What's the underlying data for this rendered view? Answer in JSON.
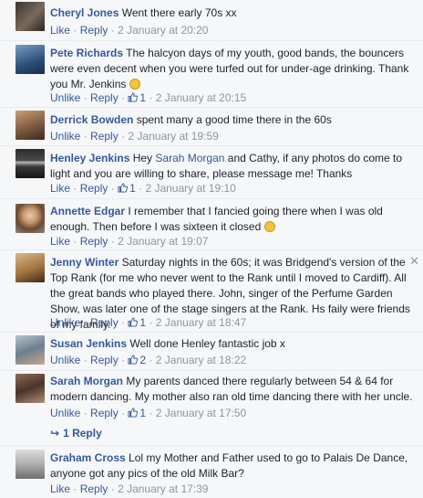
{
  "labels": {
    "unlike": "Unlike",
    "like": "Like",
    "reply": "Reply",
    "dot": "·"
  },
  "comments": [
    {
      "author": "Cheryl Jones",
      "text": "Went there early 70s xx",
      "action": "Like",
      "likes": "",
      "time": "2 January at 20:20"
    },
    {
      "author": "Pete Richards",
      "text": "The halcyon days of my youth, good bands, the bouncers were even decent when you were turfed out for under-age drinking. Thank you Mr. Jenkins",
      "action": "Unlike",
      "likes": "1",
      "time": "2 January at 20:15"
    },
    {
      "author": "Derrick Bowden",
      "text": "spent many a good time there in the 60s",
      "action": "Unlike",
      "likes": "",
      "time": "2 January at 19:59"
    },
    {
      "author": "Henley Jenkins",
      "text_before": "Hey ",
      "mention": "Sarah Morgan",
      "text_after": " and Cathy, if any photos do come to light and you are willing to share, please message me! Thanks",
      "action": "Like",
      "likes": "1",
      "time": "2 January at 19:10"
    },
    {
      "author": "Annette Edgar",
      "text": "I remember that I fancied going there when I was old enough. Then before I was sixteen it closed",
      "action": "Like",
      "likes": "",
      "time": "2 January at 19:07"
    },
    {
      "author": "Jenny Winter",
      "text": "Saturday nights in the 60s; it was Bridgend's version of the Top Rank (for me who never went to the Rank until I moved to Cardiff). All the great bands who played there. John, singer of the Perfume Garden Show, was later one of the stage singers at the Rank. Hs faily were friends of my family.",
      "action": "Unlike",
      "likes": "1",
      "time": "2 January at 18:47"
    },
    {
      "author": "Susan Jenkins",
      "text": "Well done Henley fantastic job x",
      "action": "Unlike",
      "likes": "2",
      "time": "2 January at 18:22"
    },
    {
      "author": "Sarah Morgan",
      "text": "My parents danced there regularly between 54 & 64 for modern dancing. My mother also ran old time dancing there with her uncle.",
      "action": "Unlike",
      "likes": "1",
      "time": "2 January at 17:50"
    },
    {
      "author": "Graham Cross",
      "text": "Lol my Mother and Father used to go to Palais De Dance, anyone got any pics of the old Milk Bar?",
      "action": "Like",
      "likes": "",
      "time": "2 January at 17:39"
    }
  ],
  "replies_link": "1 Reply",
  "close_glyph": "✕",
  "colors": {
    "link": "#365899",
    "meta": "#90949c",
    "background": "#f6f7f9"
  }
}
